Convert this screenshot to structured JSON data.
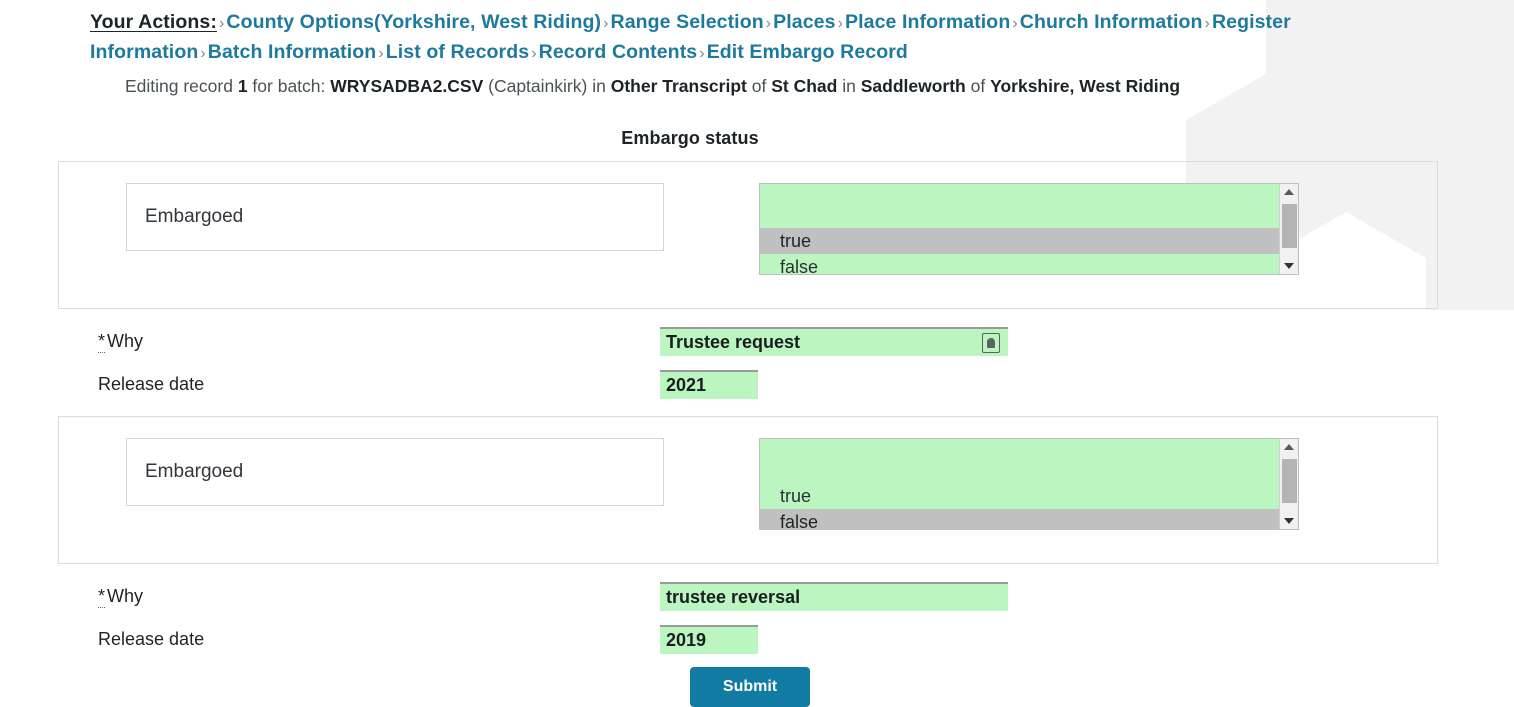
{
  "breadcrumb": {
    "first": "Your Actions:",
    "separator": "›",
    "items": [
      "County Options(Yorkshire, West Riding)",
      "Range Selection",
      "Places",
      "Place Information",
      "Church Information",
      "Register Information",
      "Batch Information",
      "List of Records",
      "Record Contents",
      "Edit Embargo Record"
    ]
  },
  "record_line": {
    "prefix": "Editing record",
    "record_number": "1",
    "for_batch_label": "for batch:",
    "batch_file": "WRYSADBA2.CSV",
    "user": "(Captainkirk)",
    "in_1": "in",
    "transcript_type": "Other Transcript",
    "of_1": "of",
    "church": "St Chad",
    "in_2": "in",
    "place": "Saddleworth",
    "of_2": "of",
    "county": "Yorkshire, West Riding"
  },
  "form": {
    "section_title": "Embargo status",
    "colors": {
      "link": "#1d7a9e",
      "autofill_green": "#bbf5bf",
      "selection_gray": "#c0c0c0",
      "button_blue": "#127ba3"
    },
    "entries": [
      {
        "status_label": "Embargoed",
        "options": [
          "true",
          "false"
        ],
        "selected": "true",
        "why_label": "* Why",
        "why_required_marker": "*",
        "why_value": "Trustee request",
        "why_has_autofill_icon": true,
        "release_date_label": "Release date",
        "release_date_value": "2021"
      },
      {
        "status_label": "Embargoed",
        "options": [
          "true",
          "false"
        ],
        "selected": "false",
        "why_label": "* Why",
        "why_required_marker": "*",
        "why_value": "trustee reversal",
        "why_has_autofill_icon": false,
        "release_date_label": "Release date",
        "release_date_value": "2019"
      }
    ],
    "submit_label": "Submit"
  }
}
